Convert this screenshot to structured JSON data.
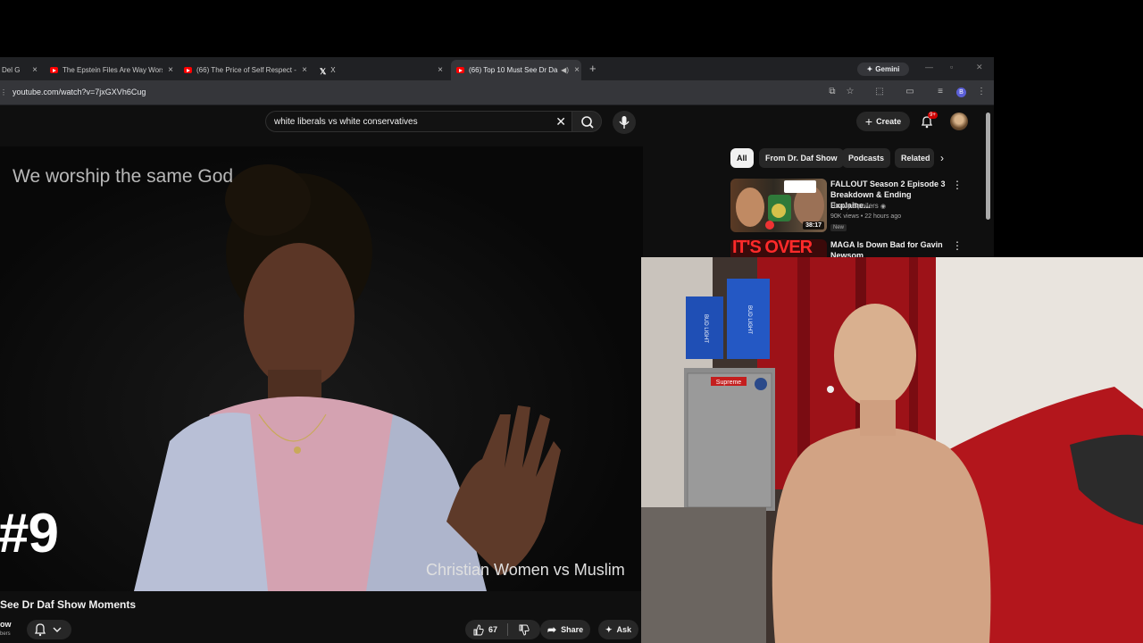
{
  "browser": {
    "tabs": [
      {
        "title": "Del G",
        "favicon": "youtube-icon",
        "active": false
      },
      {
        "title": "The Epstein Files Are Way Wors",
        "favicon": "youtube-icon",
        "active": false
      },
      {
        "title": "(66) The Price of Self Respect -",
        "favicon": "youtube-icon",
        "active": false
      },
      {
        "title": "X",
        "favicon": "x-icon",
        "active": false
      },
      {
        "title": "(66) Top 10 Must See Dr Da",
        "favicon": "youtube-icon",
        "active": true
      }
    ],
    "new_tab_label": "+",
    "gemini_label": "Gemini",
    "url": "youtube.com/watch?v=7jxGXVh6Cug",
    "profile_initial": "B",
    "colors": {
      "tabstrip": "#202124",
      "toolbar": "#35363a"
    }
  },
  "youtube": {
    "search": {
      "query": "white liberals vs white conservatives"
    },
    "create_label": "Create",
    "notification_count": "9+",
    "video": {
      "caption_top": "We worship the same God",
      "rank_overlay": "#9",
      "caption_bottom": "Christian Women vs Muslim",
      "title": "See Dr Daf Show Moments",
      "channel_fragment": "ow",
      "subs_fragment": "bers",
      "likes": "67",
      "share_label": "Share",
      "ask_label": "Ask"
    },
    "chips": [
      {
        "label": "All",
        "selected": true
      },
      {
        "label": "From Dr. Daf Show",
        "selected": false
      },
      {
        "label": "Podcasts",
        "selected": false
      },
      {
        "label": "Related",
        "selected": false
      }
    ],
    "recommendations": [
      {
        "title": "FALLOUT Season 2 Episode 3 Breakdown & Ending Explaine...",
        "channel": "Heavy Spoilers",
        "meta": "90K views • 22 hours ago",
        "badge": "New",
        "duration": "38:17",
        "thumb_text": "NOT REALLY A GHOUL?"
      },
      {
        "title": "MAGA Is Down Bad for Gavin Newsom",
        "channel": "",
        "meta": "",
        "thumb_text": "IT'S OVER"
      }
    ]
  },
  "webcam": {
    "box_labels": [
      "BUD LIGHT",
      "BUD LIGHT",
      "Supreme"
    ],
    "colors": {
      "curtain": "#a3141a",
      "wall": "#e9e4de",
      "blanket": "#b3161c"
    }
  }
}
